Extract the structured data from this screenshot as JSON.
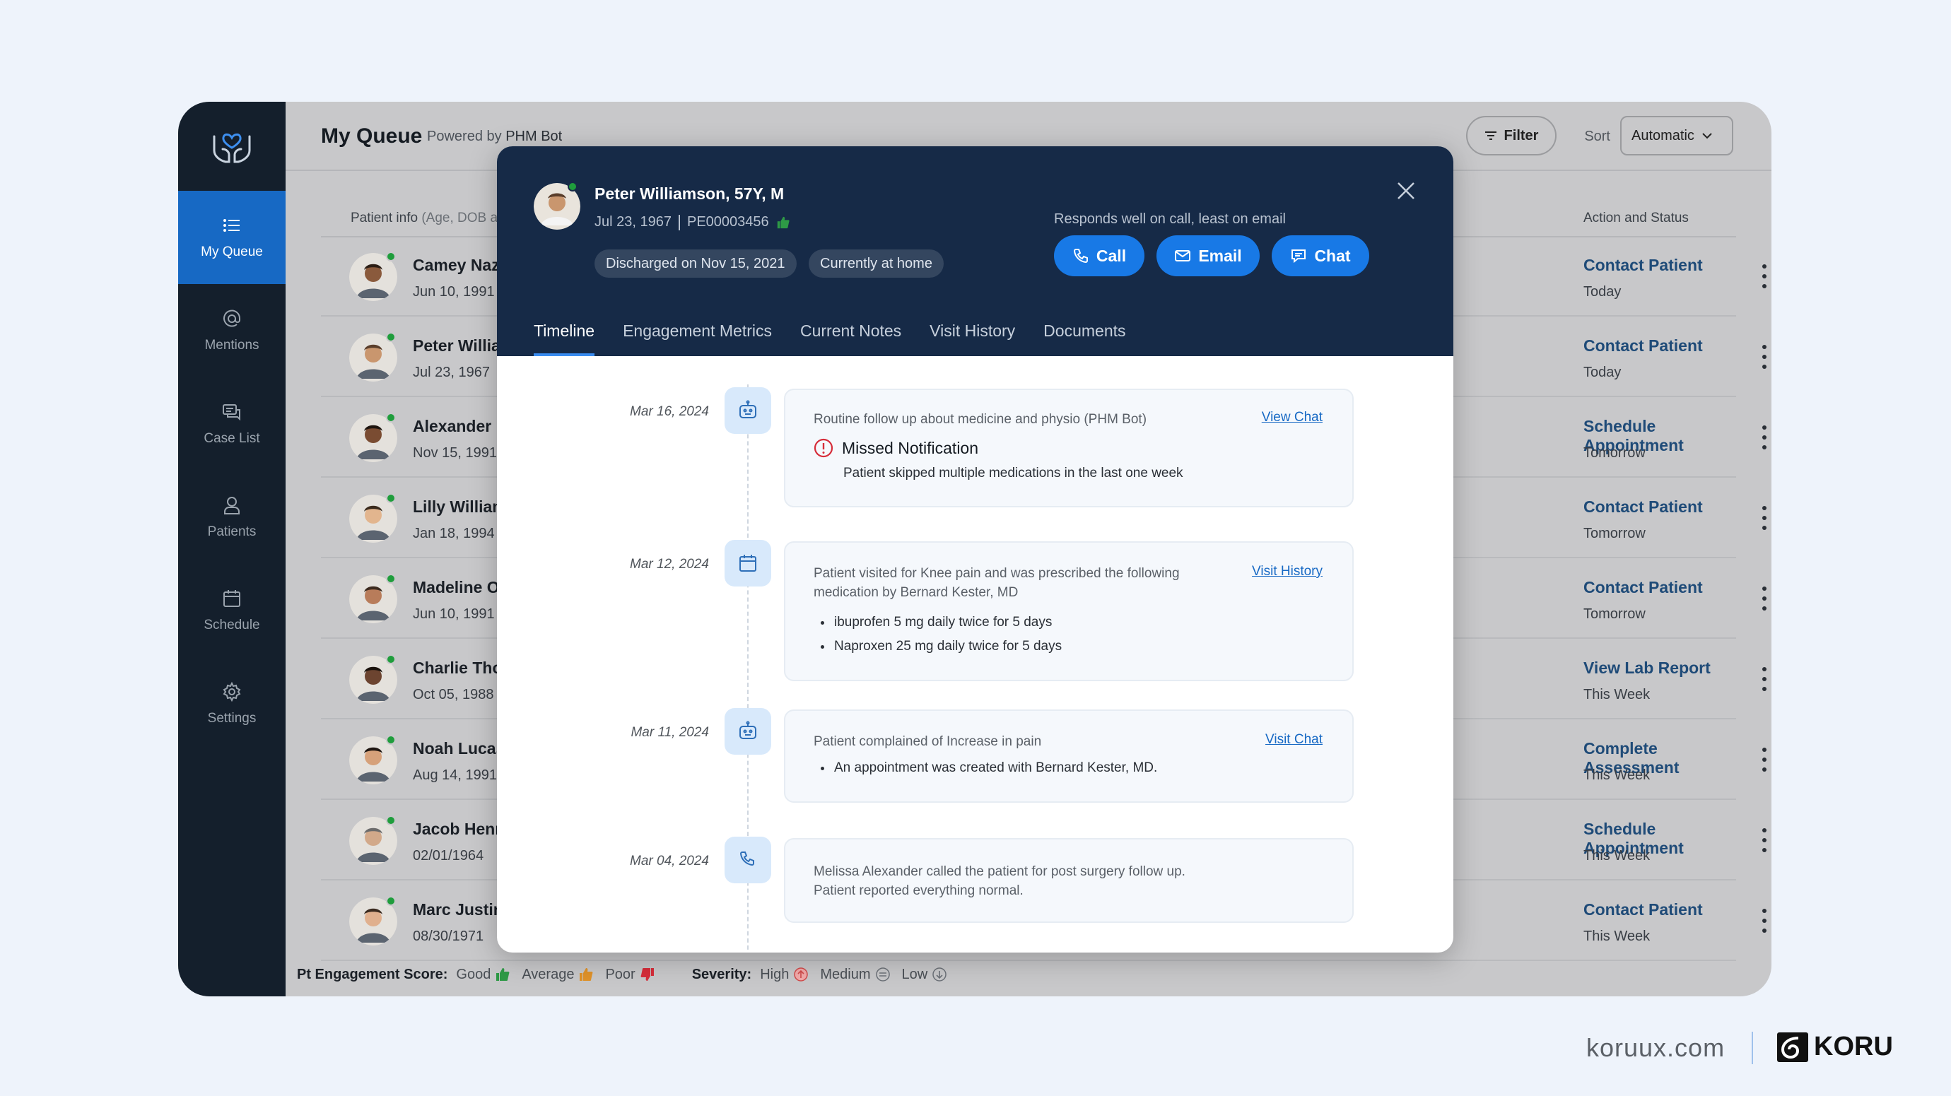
{
  "app": {
    "title": "My Queue",
    "powered_prefix": "Powered by",
    "powered_brand": "PHM Bot",
    "filter_label": "Filter",
    "sort_label": "Sort",
    "sort_value": "Automatic"
  },
  "sidebar": {
    "items": [
      {
        "label": "My Queue",
        "icon": "list-icon"
      },
      {
        "label": "Mentions",
        "icon": "at-icon"
      },
      {
        "label": "Case List",
        "icon": "chat-icon"
      },
      {
        "label": "Patients",
        "icon": "user-icon"
      },
      {
        "label": "Schedule",
        "icon": "calendar-icon"
      },
      {
        "label": "Settings",
        "icon": "gear-icon"
      }
    ]
  },
  "table": {
    "col_patient": "Patient info",
    "col_patient_sub": "(Age, DOB a",
    "col_action": "Action and Status",
    "rows": [
      {
        "name": "Camey Naz",
        "dob": "Jun 10, 1991",
        "action": "Contact Patient",
        "when": "Today"
      },
      {
        "name": "Peter Willia",
        "dob": "Jul 23, 1967",
        "action": "Contact Patient",
        "when": "Today"
      },
      {
        "name": "Alexander M",
        "dob": "Nov 15, 1991",
        "action": "Schedule Appointment",
        "when": "Tomorrow"
      },
      {
        "name": "Lilly William",
        "dob": "Jan 18, 1994",
        "action": "Contact Patient",
        "when": "Tomorrow"
      },
      {
        "name": "Madeline O",
        "dob": "Jun 10, 1991",
        "action": "Contact Patient",
        "when": "Tomorrow"
      },
      {
        "name": "Charlie Thor",
        "dob": "Oct 05, 1988",
        "action": "View Lab Report",
        "when": "This Week"
      },
      {
        "name": "Noah Lucas",
        "dob": "Aug 14, 1991",
        "action": "Complete Assessment",
        "when": "This Week"
      },
      {
        "name": "Jacob Henr",
        "dob": "02/01/1964",
        "action": "Schedule Appointment",
        "when": "This Week"
      },
      {
        "name": "Marc Justin",
        "dob": "08/30/1971",
        "action": "Contact Patient",
        "when": "This Week"
      }
    ]
  },
  "footer": {
    "engagement_label": "Pt Engagement Score:",
    "good": "Good",
    "average": "Average",
    "poor": "Poor",
    "severity_label": "Severity:",
    "high": "High",
    "medium": "Medium",
    "low": "Low"
  },
  "modal": {
    "name": "Peter Williamson, 57Y, M",
    "dob": "Jul 23, 1967",
    "pid": "PE00003456",
    "chip_discharged": "Discharged on Nov 15, 2021",
    "chip_home": "Currently at home",
    "responds": "Responds well on call, least on email",
    "call": "Call",
    "email": "Email",
    "chat": "Chat",
    "tabs": [
      "Timeline",
      "Engagement Metrics",
      "Current Notes",
      "Visit History",
      "Documents"
    ]
  },
  "timeline": [
    {
      "date": "Mar 16, 2024",
      "icon": "bot-icon",
      "text": "Routine follow up about medicine and physio (PHM Bot)",
      "link": "View Chat",
      "alert_title": "Missed Notification",
      "alert_text": "Patient skipped multiple medications in the last one week"
    },
    {
      "date": "Mar 12, 2024",
      "icon": "calendar-icon",
      "text1": "Patient visited for Knee pain and was prescribed the following",
      "text2": "medication by Bernard Kester, MD",
      "link": "Visit History",
      "bullets": [
        "ibuprofen 5 mg daily twice for 5 days",
        "Naproxen 25 mg daily twice for 5 days"
      ]
    },
    {
      "date": "Mar 11, 2024",
      "icon": "bot-icon",
      "text": "Patient complained of Increase in pain",
      "link": "Visit Chat",
      "bullets": [
        "An appointment was created with Bernard Kester, MD."
      ]
    },
    {
      "date": "Mar 04, 2024",
      "icon": "phone-icon",
      "text1": "Melissa Alexander called the patient for post surgery follow up.",
      "text2": "Patient reported everything normal."
    }
  ],
  "brand": {
    "url": "koruux.com",
    "name": "KORU"
  },
  "colors": {
    "accent": "#1879e6",
    "sidebar": "#141f2c",
    "modal_header": "#162a47",
    "online": "#1f9d3c"
  }
}
